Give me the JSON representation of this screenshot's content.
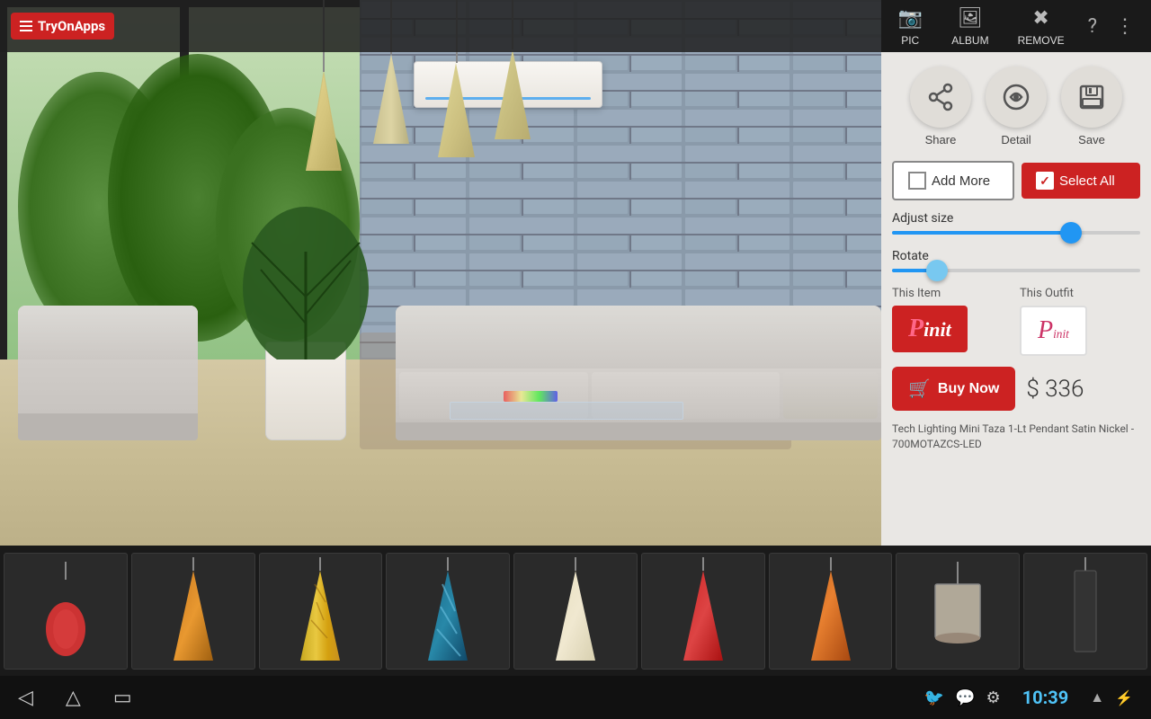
{
  "app": {
    "name": "TryOnApps"
  },
  "topbar": {
    "pic_label": "PIC",
    "album_label": "ALBUM",
    "remove_label": "REMOVE"
  },
  "rightpanel": {
    "share_label": "Share",
    "detail_label": "Detail",
    "save_label": "Save",
    "add_more_label": "Add More",
    "select_all_label": "Select All",
    "adjust_size_label": "Adjust size",
    "rotate_label": "Rotate",
    "this_item_label": "This Item",
    "this_outfit_label": "This Outfit",
    "buy_now_label": "Buy Now",
    "price": "$ 336",
    "product_name": "Tech Lighting Mini Taza 1-Lt Pendant Satin Nickel - 700MOTAZCS-LED",
    "adjust_size_value": 72,
    "rotate_value": 18
  },
  "thumbnails": [
    {
      "id": 1,
      "type": "red-globe",
      "active": false
    },
    {
      "id": 2,
      "type": "brown-cone",
      "active": false
    },
    {
      "id": 3,
      "type": "yellow-swirl",
      "active": false
    },
    {
      "id": 4,
      "type": "blue-swirl",
      "active": false
    },
    {
      "id": 5,
      "type": "cream-cone",
      "active": false
    },
    {
      "id": 6,
      "type": "red-cone",
      "active": false
    },
    {
      "id": 7,
      "type": "amber-cone",
      "active": false
    },
    {
      "id": 8,
      "type": "drum-shade",
      "active": false
    },
    {
      "id": 9,
      "type": "black-cylinder",
      "active": false
    }
  ],
  "bottomnav": {
    "time": "10:39"
  }
}
